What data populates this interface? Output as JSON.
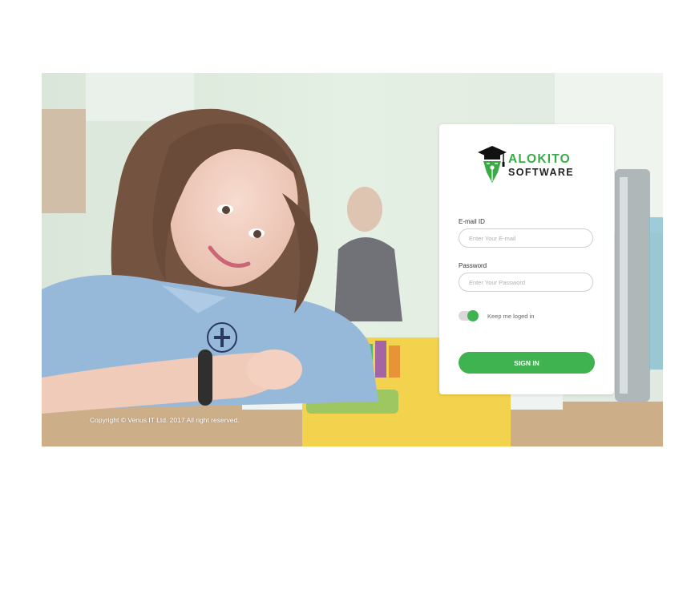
{
  "brand": {
    "line1": "ALOKITO",
    "line2": "SOFTWARE"
  },
  "email": {
    "label": "E-mail ID",
    "placeholder": "Enter Your E-mail",
    "value": ""
  },
  "password": {
    "label": "Password",
    "placeholder": "Enter Your Password",
    "value": ""
  },
  "remember": {
    "label": "Keep me loged in",
    "checked": true
  },
  "signin": {
    "label": "SIGN IN"
  },
  "footer": {
    "copyright": "Copyright © Venus IT Ltd. 2017 All right reserved."
  },
  "colors": {
    "accent": "#3fb34f",
    "brand_green": "#3aaa47",
    "brand_dark": "#222222"
  },
  "icons": [
    "graduation-cap-pen-logo"
  ]
}
